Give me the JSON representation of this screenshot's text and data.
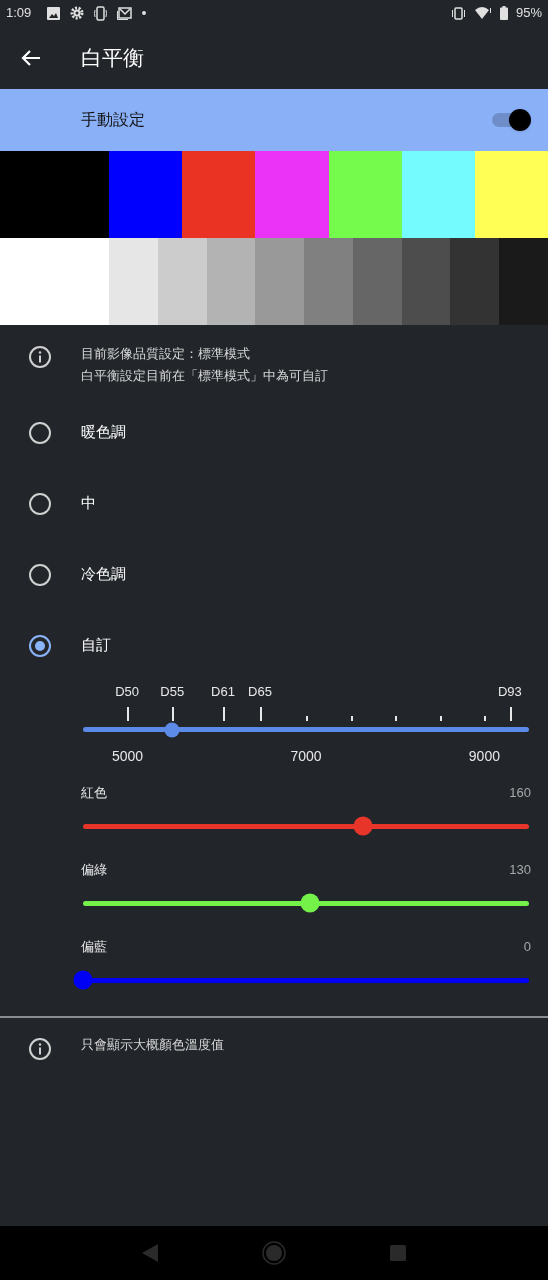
{
  "status_bar": {
    "time": "1:09",
    "battery": "95%"
  },
  "app_bar": {
    "title": "白平衡"
  },
  "manual": {
    "label": "手動設定",
    "on": true
  },
  "color_bars": [
    {
      "color": "#000000"
    },
    {
      "color": "#0000ff"
    },
    {
      "color": "#ea3323"
    },
    {
      "color": "#ea33f7"
    },
    {
      "color": "#75fb4c"
    },
    {
      "color": "#73fbfd"
    },
    {
      "color": "#ffff55"
    }
  ],
  "gray_bars": [
    {
      "color": "#ffffff"
    },
    {
      "color": "#e6e6e6"
    },
    {
      "color": "#cccccc"
    },
    {
      "color": "#b3b3b3"
    },
    {
      "color": "#999999"
    },
    {
      "color": "#808080"
    },
    {
      "color": "#666666"
    },
    {
      "color": "#4d4d4d"
    },
    {
      "color": "#333333"
    },
    {
      "color": "#1a1a1a"
    }
  ],
  "info_top": {
    "lines": [
      "目前影像品質設定：標準模式",
      "白平衡設定目前在「標準模式」中為可自訂"
    ]
  },
  "options": [
    {
      "label": "暖色調",
      "selected": false
    },
    {
      "label": "中",
      "selected": false
    },
    {
      "label": "冷色調",
      "selected": false
    },
    {
      "label": "自訂",
      "selected": true
    }
  ],
  "temperature": {
    "level": 0.2,
    "markers": [
      {
        "label": "D50"
      },
      {
        "label": "D55"
      },
      {
        "label": "D61"
      },
      {
        "label": "D65"
      },
      {
        "label": "D93"
      }
    ],
    "scale": [
      "5000",
      "7000",
      "9000"
    ]
  },
  "channels": [
    {
      "name": "紅色",
      "reading": "160",
      "level": 0.628,
      "color": "#e8352a"
    },
    {
      "name": "偏綠",
      "reading": "130",
      "level": 0.51,
      "color": "#74f24a"
    },
    {
      "name": "偏藍",
      "reading": "0",
      "level": 0,
      "color": "#0000f5"
    }
  ],
  "info_bottom": {
    "text": "只會顯示大概顏色溫度值"
  }
}
